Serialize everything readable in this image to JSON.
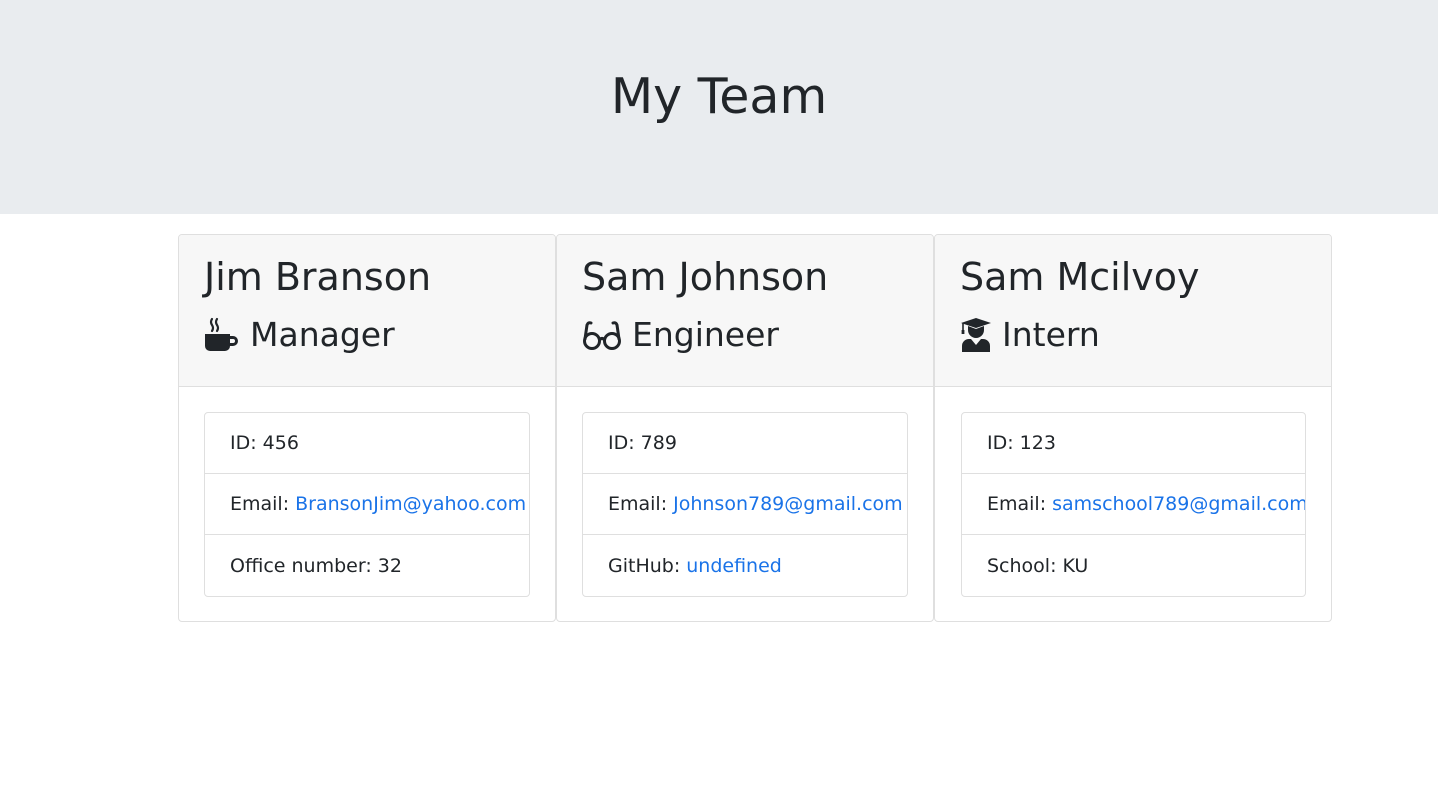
{
  "header": {
    "title": "My Team"
  },
  "employees": [
    {
      "name": "Jim Branson",
      "role": "Manager",
      "role_icon": "mug-hot-icon",
      "id_label": "ID:",
      "id": "456",
      "email_label": "Email:",
      "email": "BransonJim@yahoo.com",
      "extra_label": "Office number:",
      "extra_value": "32"
    },
    {
      "name": "Sam Johnson",
      "role": "Engineer",
      "role_icon": "glasses-icon",
      "id_label": "ID:",
      "id": "789",
      "email_label": "Email:",
      "email": "Johnson789@gmail.com",
      "extra_label": "GitHub:",
      "extra_value": "undefined"
    },
    {
      "name": "Sam Mcilvoy",
      "role": "Intern",
      "role_icon": "user-graduate-icon",
      "id_label": "ID:",
      "id": "123",
      "email_label": "Email:",
      "email": "samschool789@gmail.com",
      "extra_label": "School:",
      "extra_value": "KU"
    }
  ],
  "colors": {
    "jumbotron_bg": "#e9ecef",
    "card_header_bg": "#f7f7f7",
    "link": "#1a73e8",
    "text": "#212529"
  }
}
